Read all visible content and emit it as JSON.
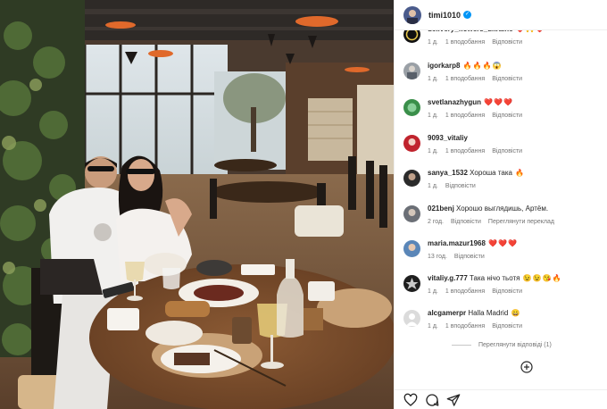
{
  "post": {
    "author": "timi1010",
    "verified": true
  },
  "comments": [
    {
      "user": "delivery_flowers_ukraine",
      "text": "",
      "emojis": [
        "❤️",
        "🙌",
        "❤️"
      ],
      "time": "1 д.",
      "likes": "1 вподобання",
      "reply": "Відповісти"
    },
    {
      "user": "igorkarp8",
      "text": "",
      "emojis": [
        "🔥",
        "🔥",
        "🔥",
        "😱"
      ],
      "time": "1 д.",
      "likes": "1 вподобання",
      "reply": "Відповісти"
    },
    {
      "user": "svetlanazhygun",
      "text": "",
      "emojis": [
        "❤️",
        "❤️",
        "❤️"
      ],
      "time": "1 д.",
      "likes": "1 вподобання",
      "reply": "Відповісти"
    },
    {
      "user": "9093_vitaliy",
      "text": "",
      "emojis": [],
      "time": "1 д.",
      "likes": "1 вподобання",
      "reply": "Відповісти"
    },
    {
      "user": "sanya_1532",
      "text": "Хороша така",
      "emojis": [
        "🔥"
      ],
      "time": "1 д.",
      "likes": "",
      "reply": "Відповісти"
    },
    {
      "user": "021benj",
      "text": "Хорошо выглядишь, Артём.",
      "emojis": [],
      "time": "2 год.",
      "likes": "",
      "reply": "Відповісти",
      "translate": "Переглянути переклад"
    },
    {
      "user": "maria.mazur1968",
      "text": "",
      "emojis": [
        "❤️",
        "❤️",
        "❤️"
      ],
      "time": "13 год.",
      "likes": "",
      "reply": "Відповісти"
    },
    {
      "user": "vitaliy.g.777",
      "text": "Така нічо тьотя",
      "emojis": [
        "😉",
        "😉",
        "😘",
        "🔥"
      ],
      "time": "1 д.",
      "likes": "1 вподобання",
      "reply": "Відповісти"
    },
    {
      "user": "alcgamerpr",
      "text": "Halla Madrid",
      "emojis": [
        "😀"
      ],
      "time": "1 д.",
      "likes": "1 вподобання",
      "reply": "Відповісти"
    }
  ],
  "view_replies": "Переглянути відповіді (1)",
  "colors": {
    "verified_blue": "#0095f6",
    "meta_gray": "#737373",
    "text": "#262626"
  }
}
